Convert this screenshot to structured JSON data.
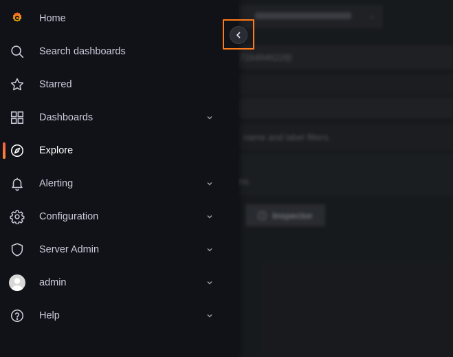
{
  "background": {
    "query_hint": "7164946228)",
    "filter_hint": "name and label filters.",
    "options_hint": "ons.",
    "inspector_label": "Inspector"
  },
  "nav": {
    "items": [
      {
        "label": "Home",
        "icon": "grafana-logo-icon",
        "has_chevron": false
      },
      {
        "label": "Search dashboards",
        "icon": "search-icon",
        "has_chevron": false
      },
      {
        "label": "Starred",
        "icon": "star-icon",
        "has_chevron": false
      },
      {
        "label": "Dashboards",
        "icon": "apps-grid-icon",
        "has_chevron": true
      },
      {
        "label": "Explore",
        "icon": "compass-icon",
        "has_chevron": false,
        "active": true
      },
      {
        "label": "Alerting",
        "icon": "bell-icon",
        "has_chevron": true
      },
      {
        "label": "Configuration",
        "icon": "gear-icon",
        "has_chevron": true
      },
      {
        "label": "Server Admin",
        "icon": "shield-icon",
        "has_chevron": true
      },
      {
        "label": "admin",
        "icon": "avatar",
        "has_chevron": true
      },
      {
        "label": "Help",
        "icon": "question-circle-icon",
        "has_chevron": true
      }
    ]
  },
  "colors": {
    "accent": "#ff7a1a",
    "active_bar": "#f55f3e",
    "sidebar_bg": "#111217",
    "text": "#ccccdc"
  }
}
